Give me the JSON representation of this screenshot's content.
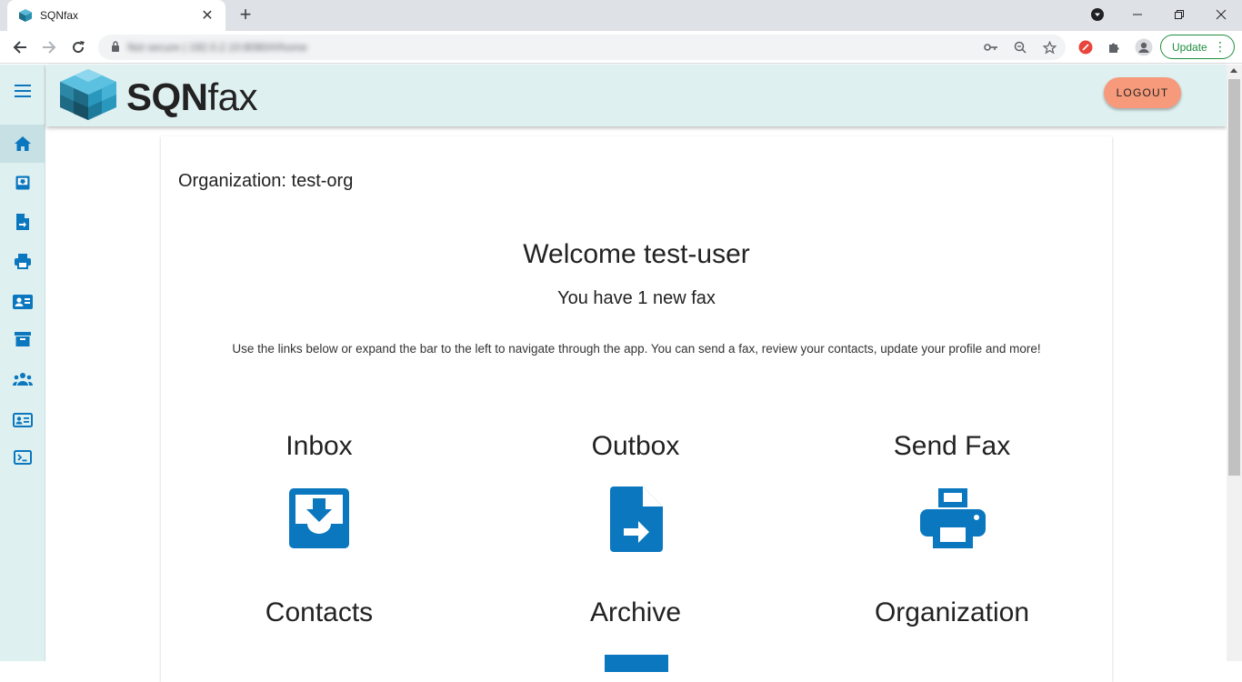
{
  "browser": {
    "tab_title": "SQNfax",
    "url": "Not secure | 192.0.2.10:8080/#/home",
    "update_label": "Update"
  },
  "app": {
    "logo_bold": "SQN",
    "logo_light": "fax",
    "logout_label": "LOGOUT",
    "accent_color": "#0a77bf",
    "logout_color": "#f79a7b"
  },
  "sidebar": {
    "items": [
      {
        "icon": "home-icon"
      },
      {
        "icon": "inbox-icon"
      },
      {
        "icon": "outbox-icon"
      },
      {
        "icon": "printer-icon"
      },
      {
        "icon": "contacts-icon"
      },
      {
        "icon": "archive-icon"
      },
      {
        "icon": "organization-icon"
      },
      {
        "icon": "profile-card-icon"
      },
      {
        "icon": "terminal-icon"
      }
    ]
  },
  "main": {
    "organization": "Organization: test-org",
    "welcome": "Welcome test-user",
    "new_fax": "You have 1 new fax",
    "help_text": "Use the links below or expand the bar to the left to navigate through the app. You can send a fax, review your contacts, update your profile and more!",
    "links": [
      {
        "label": "Inbox",
        "icon": "inbox-icon"
      },
      {
        "label": "Outbox",
        "icon": "outbox-icon"
      },
      {
        "label": "Send Fax",
        "icon": "printer-icon"
      },
      {
        "label": "Contacts",
        "icon": "contacts-icon"
      },
      {
        "label": "Archive",
        "icon": "archive-icon"
      },
      {
        "label": "Organization",
        "icon": "organization-icon"
      }
    ]
  }
}
